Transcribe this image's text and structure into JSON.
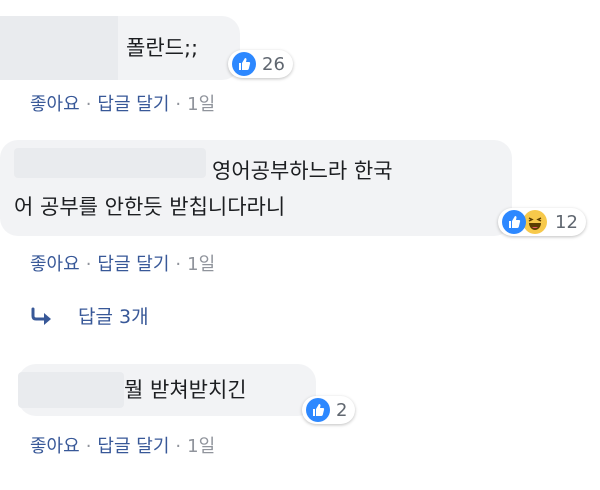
{
  "comments": [
    {
      "text": "폴란드;;",
      "reaction_count": "26",
      "actions": {
        "like": "좋아요",
        "reply": "답글 달기",
        "time": "1일"
      }
    },
    {
      "text_line1": "영어공부하느라 한국",
      "text_line2": "어 공부를 안한듯 받칩니다라니",
      "reaction_count": "12",
      "actions": {
        "like": "좋아요",
        "reply": "답글 달기",
        "time": "1일"
      },
      "replies_label": "답글 3개"
    },
    {
      "text": "뭘 받쳐받치긴",
      "reaction_count": "2",
      "actions": {
        "like": "좋아요",
        "reply": "답글 달기",
        "time": "1일"
      }
    }
  ],
  "colors": {
    "link": "#385898",
    "like_blue": "#2d88ff",
    "haha_yellow": "#f7c94b",
    "bubble": "#f2f3f5"
  },
  "icons": [
    "like-icon",
    "haha-icon",
    "reply-arrow-icon"
  ]
}
